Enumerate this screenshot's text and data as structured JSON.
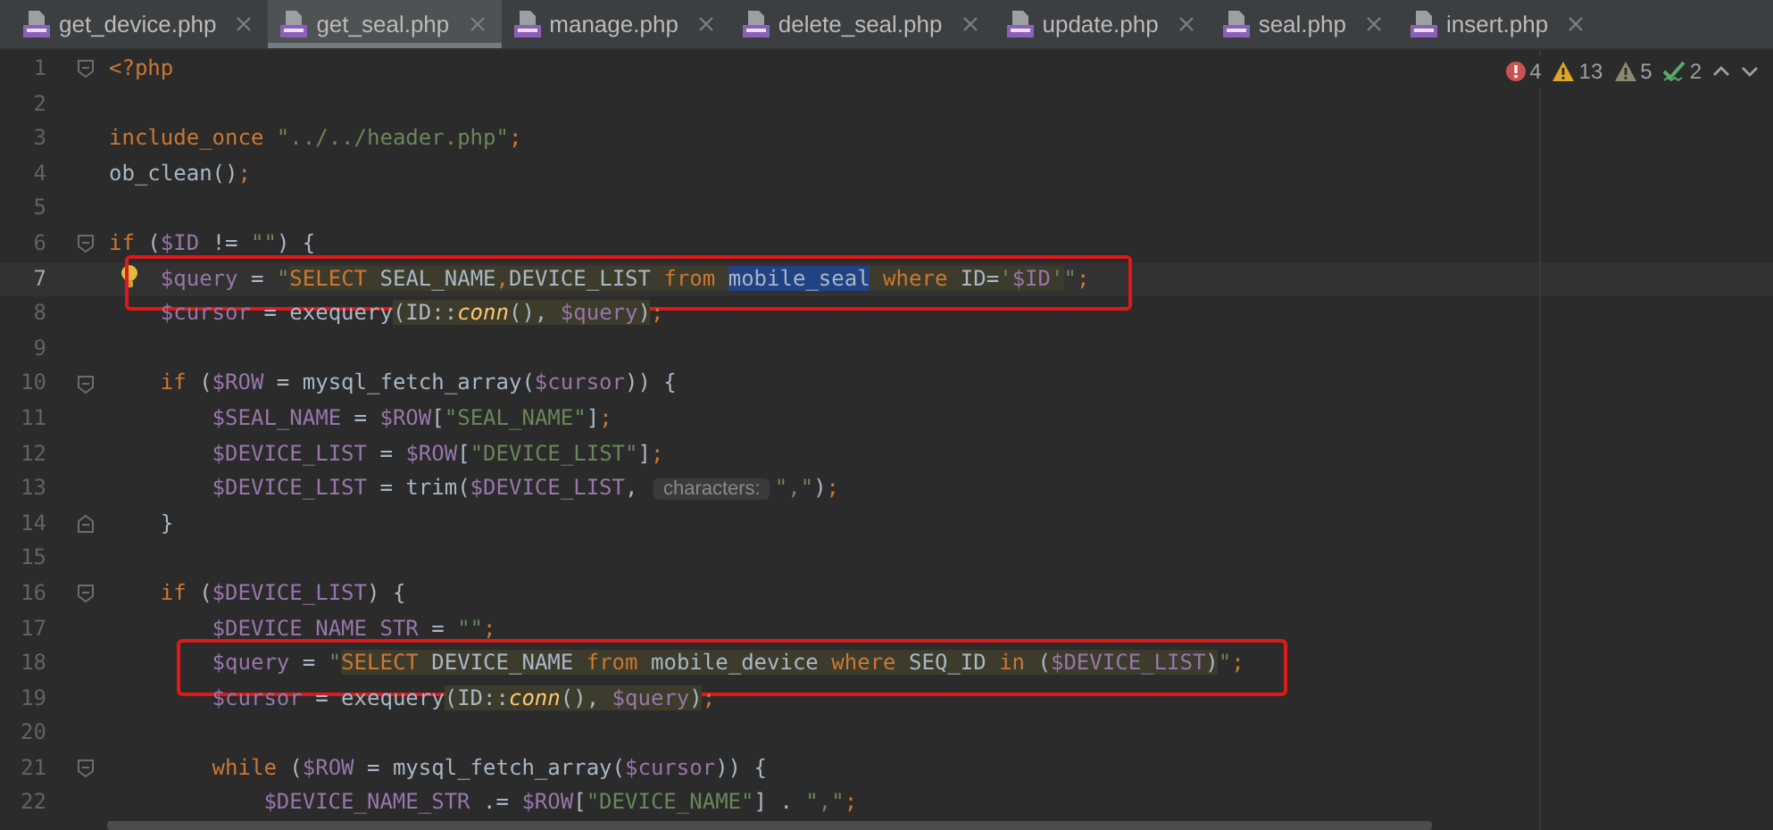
{
  "tabs": [
    {
      "label": "get_device.php",
      "selected": false
    },
    {
      "label": "get_seal.php",
      "selected": true
    },
    {
      "label": "manage.php",
      "selected": false
    },
    {
      "label": "delete_seal.php",
      "selected": false
    },
    {
      "label": "update.php",
      "selected": false
    },
    {
      "label": "seal.php",
      "selected": false
    },
    {
      "label": "insert.php",
      "selected": false
    }
  ],
  "inspections": [
    {
      "kind": "error",
      "count": "4"
    },
    {
      "kind": "warning",
      "count": "13"
    },
    {
      "kind": "weak",
      "count": "5"
    },
    {
      "kind": "typo",
      "count": "2"
    }
  ],
  "lines": [
    {
      "number": "1",
      "fold_start": true,
      "tokens": [
        {
          "t": "<?php",
          "kind": "keyword"
        }
      ]
    },
    {
      "number": "2"
    },
    {
      "number": "3",
      "tokens": [
        {
          "t": "include_once",
          "kind": "keyword"
        },
        {
          "t": " \"../../header.php\"",
          "kind": "string"
        },
        {
          "t": ";",
          "kind": "keyword"
        }
      ]
    },
    {
      "number": "4",
      "tokens": [
        {
          "t": "ob_clean()",
          "kind": "text"
        },
        {
          "t": ";",
          "kind": "keyword"
        }
      ]
    },
    {
      "number": "5"
    },
    {
      "number": "6",
      "fold_start": true,
      "tokens": [
        {
          "t": "if",
          "kind": "keyword"
        },
        {
          "t": " (",
          "kind": "text"
        },
        {
          "t": "$ID",
          "kind": "variable"
        },
        {
          "t": " != ",
          "kind": "text"
        },
        {
          "t": "\"\"",
          "kind": "string"
        },
        {
          "t": ") {",
          "kind": "text"
        }
      ],
      "children": [
        {
          "number": "7",
          "current": true,
          "bulb": true,
          "boxed": true,
          "tokens": [
            {
              "t": "$query",
              "kind": "variable"
            },
            {
              "t": " = ",
              "kind": "text"
            },
            {
              "t": "\"",
              "kind": "string"
            },
            {
              "t": "SELECT",
              "kind": "keyword",
              "injected": true
            },
            {
              "t": " SEAL_NAME",
              "kind": "text",
              "injected": true
            },
            {
              "t": ",",
              "kind": "keyword",
              "injected": true
            },
            {
              "t": "DEVICE_LIST ",
              "kind": "text",
              "injected": true
            },
            {
              "t": "from ",
              "kind": "keyword",
              "injected": true
            },
            {
              "t": "mobile_seal",
              "kind": "text",
              "selected": true
            },
            {
              "t": " where",
              "kind": "keyword",
              "injected": true
            },
            {
              "t": " ID=",
              "kind": "text",
              "injected": true
            },
            {
              "t": "'",
              "kind": "string",
              "injected": true
            },
            {
              "t": "$ID",
              "kind": "variable",
              "injected": true
            },
            {
              "t": "'",
              "kind": "string",
              "injected": true
            },
            {
              "t": "\"",
              "kind": "string"
            },
            {
              "t": ";",
              "kind": "keyword"
            }
          ]
        },
        {
          "number": "8",
          "tokens": [
            {
              "t": "$cursor",
              "kind": "variable"
            },
            {
              "t": " = exequery",
              "kind": "text"
            },
            {
              "t": "(ID::",
              "kind": "text",
              "injected": true
            },
            {
              "t": "conn",
              "kind": "static",
              "injected": true
            },
            {
              "t": "(), ",
              "kind": "text",
              "injected": true
            },
            {
              "t": "$query",
              "kind": "variable",
              "injected": true
            },
            {
              "t": ")",
              "kind": "text",
              "injected": true
            },
            {
              "t": ";",
              "kind": "keyword"
            }
          ]
        },
        {
          "number": "9"
        },
        {
          "number": "10",
          "fold_start": true,
          "tokens": [
            {
              "t": "if",
              "kind": "keyword"
            },
            {
              "t": " (",
              "kind": "text"
            },
            {
              "t": "$ROW",
              "kind": "variable"
            },
            {
              "t": " = mysql_fetch_array(",
              "kind": "text"
            },
            {
              "t": "$cursor",
              "kind": "variable"
            },
            {
              "t": ")) {",
              "kind": "text"
            }
          ],
          "children": [
            {
              "number": "11",
              "tokens": [
                {
                  "t": "$SEAL_NAME",
                  "kind": "variable"
                },
                {
                  "t": " = ",
                  "kind": "text"
                },
                {
                  "t": "$ROW",
                  "kind": "variable"
                },
                {
                  "t": "[",
                  "kind": "text"
                },
                {
                  "t": "\"SEAL_NAME\"",
                  "kind": "string"
                },
                {
                  "t": "]",
                  "kind": "text"
                },
                {
                  "t": ";",
                  "kind": "keyword"
                }
              ]
            },
            {
              "number": "12",
              "tokens": [
                {
                  "t": "$DEVICE_LIST",
                  "kind": "variable"
                },
                {
                  "t": " = ",
                  "kind": "text"
                },
                {
                  "t": "$ROW",
                  "kind": "variable"
                },
                {
                  "t": "[",
                  "kind": "text"
                },
                {
                  "t": "\"DEVICE_LIST\"",
                  "kind": "string"
                },
                {
                  "t": "]",
                  "kind": "text"
                },
                {
                  "t": ";",
                  "kind": "keyword"
                }
              ]
            },
            {
              "number": "13",
              "tokens": [
                {
                  "t": "$DEVICE_LIST",
                  "kind": "variable"
                },
                {
                  "t": " = trim(",
                  "kind": "text"
                },
                {
                  "t": "$DEVICE_LIST",
                  "kind": "variable"
                },
                {
                  "t": ", ",
                  "kind": "text"
                },
                {
                  "t": "characters:",
                  "kind": "hint"
                },
                {
                  "t": "\",\"",
                  "kind": "string"
                },
                {
                  "t": ")",
                  "kind": "text"
                },
                {
                  "t": ";",
                  "kind": "keyword"
                }
              ]
            }
          ]
        },
        {
          "number": "14",
          "fold_end": true,
          "tokens": [
            {
              "t": "}",
              "kind": "text"
            }
          ]
        },
        {
          "number": "15"
        },
        {
          "number": "16",
          "fold_start": true,
          "tokens": [
            {
              "t": "if",
              "kind": "keyword"
            },
            {
              "t": " (",
              "kind": "text"
            },
            {
              "t": "$DEVICE_LIST",
              "kind": "variable"
            },
            {
              "t": ") {",
              "kind": "text"
            }
          ],
          "children": [
            {
              "number": "17",
              "tokens": [
                {
                  "t": "$DEVICE_NAME_STR",
                  "kind": "variable"
                },
                {
                  "t": " = ",
                  "kind": "text"
                },
                {
                  "t": "\"\"",
                  "kind": "string"
                },
                {
                  "t": ";",
                  "kind": "keyword"
                }
              ]
            },
            {
              "number": "18",
              "boxed": true,
              "tokens": [
                {
                  "t": "$query",
                  "kind": "variable"
                },
                {
                  "t": " = ",
                  "kind": "text"
                },
                {
                  "t": "\"",
                  "kind": "string"
                },
                {
                  "t": "SELECT",
                  "kind": "keyword",
                  "injected": true
                },
                {
                  "t": " DEVICE_NAME ",
                  "kind": "text",
                  "injected": true
                },
                {
                  "t": "from",
                  "kind": "keyword",
                  "injected": true
                },
                {
                  "t": " mobile_device ",
                  "kind": "text",
                  "injected": true
                },
                {
                  "t": "where",
                  "kind": "keyword",
                  "injected": true
                },
                {
                  "t": " SEQ_ID ",
                  "kind": "text",
                  "injected": true
                },
                {
                  "t": "in",
                  "kind": "keyword",
                  "injected": true
                },
                {
                  "t": " (",
                  "kind": "text",
                  "injected": true
                },
                {
                  "t": "$DEVICE_LIST",
                  "kind": "variable",
                  "injected": true
                },
                {
                  "t": ")",
                  "kind": "text",
                  "injected": true
                },
                {
                  "t": "\"",
                  "kind": "string"
                },
                {
                  "t": ";",
                  "kind": "keyword"
                }
              ]
            },
            {
              "number": "19",
              "tokens": [
                {
                  "t": "$cursor",
                  "kind": "variable"
                },
                {
                  "t": " = exequery",
                  "kind": "text"
                },
                {
                  "t": "(ID::",
                  "kind": "text",
                  "injected": true
                },
                {
                  "t": "conn",
                  "kind": "static",
                  "injected": true
                },
                {
                  "t": "(), ",
                  "kind": "text",
                  "injected": true
                },
                {
                  "t": "$query",
                  "kind": "variable",
                  "injected": true
                },
                {
                  "t": ")",
                  "kind": "text",
                  "injected": true
                },
                {
                  "t": ";",
                  "kind": "keyword"
                }
              ]
            },
            {
              "number": "20"
            },
            {
              "number": "21",
              "fold_start": true,
              "tokens": [
                {
                  "t": "while",
                  "kind": "keyword"
                },
                {
                  "t": " (",
                  "kind": "text"
                },
                {
                  "t": "$ROW",
                  "kind": "variable"
                },
                {
                  "t": " = mysql_fetch_array(",
                  "kind": "text"
                },
                {
                  "t": "$cursor",
                  "kind": "variable"
                },
                {
                  "t": ")) {",
                  "kind": "text"
                }
              ],
              "children": [
                {
                  "number": "22",
                  "tokens": [
                    {
                      "t": "$DEVICE_NAME_STR",
                      "kind": "variable"
                    },
                    {
                      "t": " .= ",
                      "kind": "text"
                    },
                    {
                      "t": "$ROW",
                      "kind": "variable"
                    },
                    {
                      "t": "[",
                      "kind": "text"
                    },
                    {
                      "t": "\"DEVICE_NAME\"",
                      "kind": "string"
                    },
                    {
                      "t": "]",
                      "kind": "text"
                    },
                    {
                      "t": " . ",
                      "kind": "text"
                    },
                    {
                      "t": "\",\"",
                      "kind": "string"
                    },
                    {
                      "t": ";",
                      "kind": "keyword"
                    }
                  ]
                }
              ]
            }
          ]
        }
      ]
    }
  ]
}
